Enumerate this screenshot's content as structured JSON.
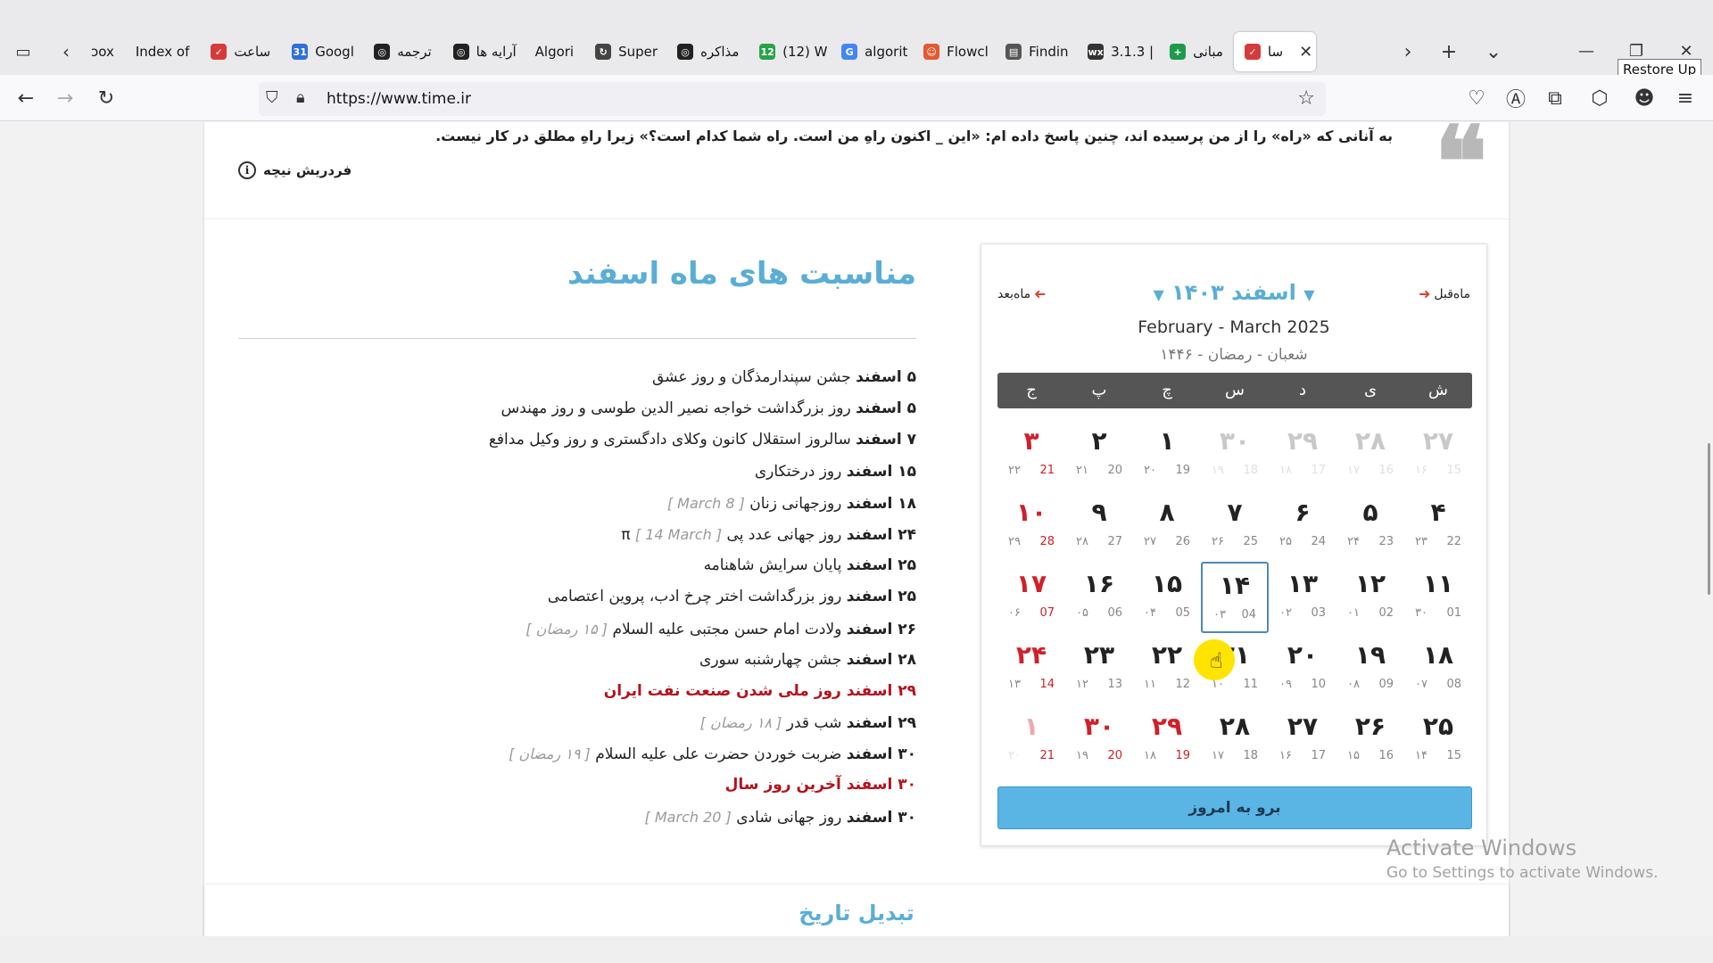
{
  "browser": {
    "tooltip": "Restore Up",
    "tabs": [
      {
        "label": "ɔox",
        "favicon": "",
        "color": "#eaeaed"
      },
      {
        "label": "Index of",
        "favicon": "",
        "color": "#eaeaed"
      },
      {
        "label": "ساعت",
        "favicon": "✓",
        "color": "#d63a3a"
      },
      {
        "label": "Googl",
        "favicon": "31",
        "color": "#2f6fd8"
      },
      {
        "label": "ترجمه",
        "favicon": "◎",
        "color": "#222222"
      },
      {
        "label": "آرایه ها",
        "favicon": "◎",
        "color": "#222222"
      },
      {
        "label": "Algori",
        "favicon": "",
        "color": "#eaeaed"
      },
      {
        "label": "Super",
        "favicon": "↻",
        "color": "#444444"
      },
      {
        "label": "مذاکره",
        "favicon": "◎",
        "color": "#222222"
      },
      {
        "label": "(12) W",
        "favicon": "12",
        "color": "#2aa24a"
      },
      {
        "label": "algorit",
        "favicon": "G",
        "color": "#4285f4"
      },
      {
        "label": "Flowcl",
        "favicon": "☺",
        "color": "#e25a30"
      },
      {
        "label": "Findin",
        "favicon": "▤",
        "color": "#555555"
      },
      {
        "label": "3.1.3 |",
        "favicon": "wx",
        "color": "#333333"
      },
      {
        "label": "مبانی",
        "favicon": "+",
        "color": "#1e9a4a"
      },
      {
        "label": "سا",
        "favicon": "✓",
        "color": "#d63a3a",
        "active": true
      }
    ],
    "url": "https://www.time.ir"
  },
  "quote": {
    "text": "به آنانی که «راه» را از من پرسیده اند، چنین پاسخ داده ام: «این _ اکنون راهِ من است. راه شما کدام است؟» زیرا راهِ مطلق در کار نیست.",
    "author": "فردریش نیچه",
    "mark": "❝",
    "info": "i"
  },
  "occasions": {
    "title": "مناسبت های ماه اسفند",
    "items": [
      {
        "day": "۵ اسفند",
        "text": "جشن سپندارمذگان و روز عشق",
        "note": ""
      },
      {
        "day": "۵ اسفند",
        "text": "روز بزرگداشت خواجه نصیر الدین طوسی و روز مهندس",
        "note": ""
      },
      {
        "day": "۷ اسفند",
        "text": "سالروز استقلال کانون وکلای دادگستری و روز وکیل مدافع",
        "note": ""
      },
      {
        "day": "۱۵ اسفند",
        "text": "روز درختکاری",
        "note": ""
      },
      {
        "day": "۱۸ اسفند",
        "text": "روزجهانی زنان",
        "note": "[ 8 March ]"
      },
      {
        "day": "۲۴ اسفند",
        "text": "روز جهانی عدد پی π",
        "note": "[ 14 March ]"
      },
      {
        "day": "۲۵ اسفند",
        "text": "پایان سرایش شاهنامه",
        "note": ""
      },
      {
        "day": "۲۵ اسفند",
        "text": "روز بزرگداشت اختر چرخ ادب، پروین اعتصامی",
        "note": ""
      },
      {
        "day": "۲۶ اسفند",
        "text": "ولادت امام حسن مجتبی علیه السلام",
        "note": "[ ۱۵ رمضان ]"
      },
      {
        "day": "۲۸ اسفند",
        "text": "جشن چهارشنبه سوری",
        "note": ""
      },
      {
        "day": "۲۹ اسفند",
        "text": "روز ملی شدن صنعت نفت ایران",
        "note": "",
        "holiday": true
      },
      {
        "day": "۲۹ اسفند",
        "text": "شب قدر",
        "note": "[ ۱۸ رمضان ]"
      },
      {
        "day": "۳۰ اسفند",
        "text": "ضربت خوردن حضرت علی علیه السلام",
        "note": "[ ۱۹ رمضان ]"
      },
      {
        "day": "۳۰ اسفند",
        "text": "آخرین روز سال",
        "note": "",
        "holiday": true
      },
      {
        "day": "۳۰ اسفند",
        "text": "روز جهانی شادی",
        "note": "[ 20 March ]"
      }
    ]
  },
  "calendar": {
    "prev_label": "ماه‌قبل",
    "next_label": "ماه‌بعد",
    "month_title": "اسفند ۱۴۰۳",
    "gregorian": "February - March 2025",
    "hijri": "شعبان - رمضان - ۱۴۴۶",
    "weekdays": [
      "ش",
      "ی",
      "د",
      "س",
      "چ",
      "پ",
      "ج"
    ],
    "days": [
      {
        "p": "۲۷",
        "h": "۱۶",
        "g": "15",
        "other": true
      },
      {
        "p": "۲۸",
        "h": "۱۷",
        "g": "16",
        "other": true
      },
      {
        "p": "۲۹",
        "h": "۱۸",
        "g": "17",
        "other": true
      },
      {
        "p": "۳۰",
        "h": "۱۹",
        "g": "18",
        "other": true
      },
      {
        "p": "۱",
        "h": "۲۰",
        "g": "19"
      },
      {
        "p": "۲",
        "h": "۲۱",
        "g": "20"
      },
      {
        "p": "۳",
        "h": "۲۲",
        "g": "21",
        "holiday": true
      },
      {
        "p": "۴",
        "h": "۲۳",
        "g": "22"
      },
      {
        "p": "۵",
        "h": "۲۴",
        "g": "23"
      },
      {
        "p": "۶",
        "h": "۲۵",
        "g": "24"
      },
      {
        "p": "۷",
        "h": "۲۶",
        "g": "25"
      },
      {
        "p": "۸",
        "h": "۲۷",
        "g": "26"
      },
      {
        "p": "۹",
        "h": "۲۸",
        "g": "27"
      },
      {
        "p": "۱۰",
        "h": "۲۹",
        "g": "28",
        "holiday": true
      },
      {
        "p": "۱۱",
        "h": "۳۰",
        "g": "01"
      },
      {
        "p": "۱۲",
        "h": "۰۱",
        "g": "02"
      },
      {
        "p": "۱۳",
        "h": "۰۲",
        "g": "03"
      },
      {
        "p": "۱۴",
        "h": "۰۳",
        "g": "04",
        "today": true
      },
      {
        "p": "۱۵",
        "h": "۰۴",
        "g": "05"
      },
      {
        "p": "۱۶",
        "h": "۰۵",
        "g": "06"
      },
      {
        "p": "۱۷",
        "h": "۰۶",
        "g": "07",
        "holiday": true
      },
      {
        "p": "۱۸",
        "h": "۰۷",
        "g": "08"
      },
      {
        "p": "۱۹",
        "h": "۰۸",
        "g": "09"
      },
      {
        "p": "۲۰",
        "h": "۰۹",
        "g": "10"
      },
      {
        "p": "۲۱",
        "h": "۱۰",
        "g": "11"
      },
      {
        "p": "۲۲",
        "h": "۱۱",
        "g": "12"
      },
      {
        "p": "۲۳",
        "h": "۱۲",
        "g": "13"
      },
      {
        "p": "۲۴",
        "h": "۱۳",
        "g": "14",
        "holiday": true
      },
      {
        "p": "۲۵",
        "h": "۱۴",
        "g": "15"
      },
      {
        "p": "۲۶",
        "h": "۱۵",
        "g": "16"
      },
      {
        "p": "۲۷",
        "h": "۱۶",
        "g": "17"
      },
      {
        "p": "۲۸",
        "h": "۱۷",
        "g": "18"
      },
      {
        "p": "۲۹",
        "h": "۱۸",
        "g": "19",
        "holiday": true
      },
      {
        "p": "۳۰",
        "h": "۱۹",
        "g": "20",
        "holiday": true
      },
      {
        "p": "۱",
        "h": "۲۰",
        "g": "21",
        "other": true,
        "holiday": true
      }
    ],
    "today_button": "برو به امروز"
  },
  "convert_title": "تبدیل تاریخ",
  "watermark": {
    "line1": "Activate Windows",
    "line2": "Go to Settings to activate Windows."
  },
  "colors": {
    "accent": "#5aaed6",
    "holiday": "#d0202a",
    "button": "#5bb5e4"
  }
}
